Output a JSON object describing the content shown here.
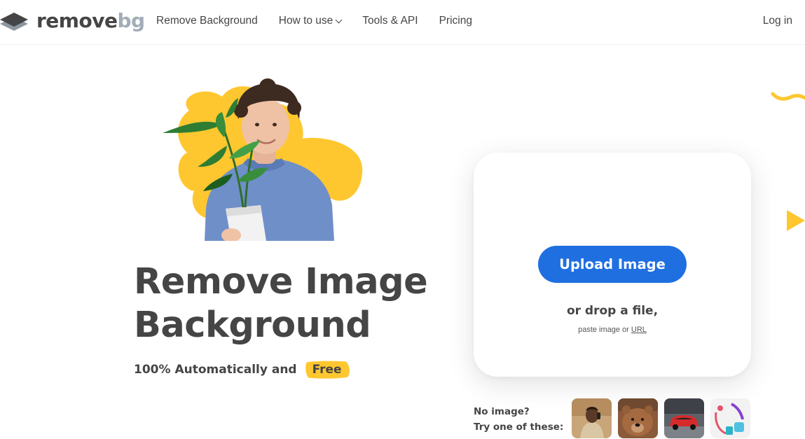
{
  "header": {
    "logo": {
      "part1": "remove",
      "part2": "bg"
    },
    "nav": [
      {
        "label": "Remove Background"
      },
      {
        "label": "How to use"
      },
      {
        "label": "Tools & API"
      },
      {
        "label": "Pricing"
      }
    ],
    "login": "Log in"
  },
  "hero": {
    "title_line1": "Remove Image",
    "title_line2": "Background",
    "subtitle": "100% Automatically and",
    "badge": "Free"
  },
  "upload": {
    "button": "Upload Image",
    "drop_text": "or drop a file,",
    "paste_text": "paste image or",
    "url_link": "URL"
  },
  "samples": {
    "line1": "No image?",
    "line2": "Try one of these:"
  },
  "colors": {
    "accent": "#1f6fe0",
    "yellow": "#fec72f",
    "text": "#454545"
  }
}
